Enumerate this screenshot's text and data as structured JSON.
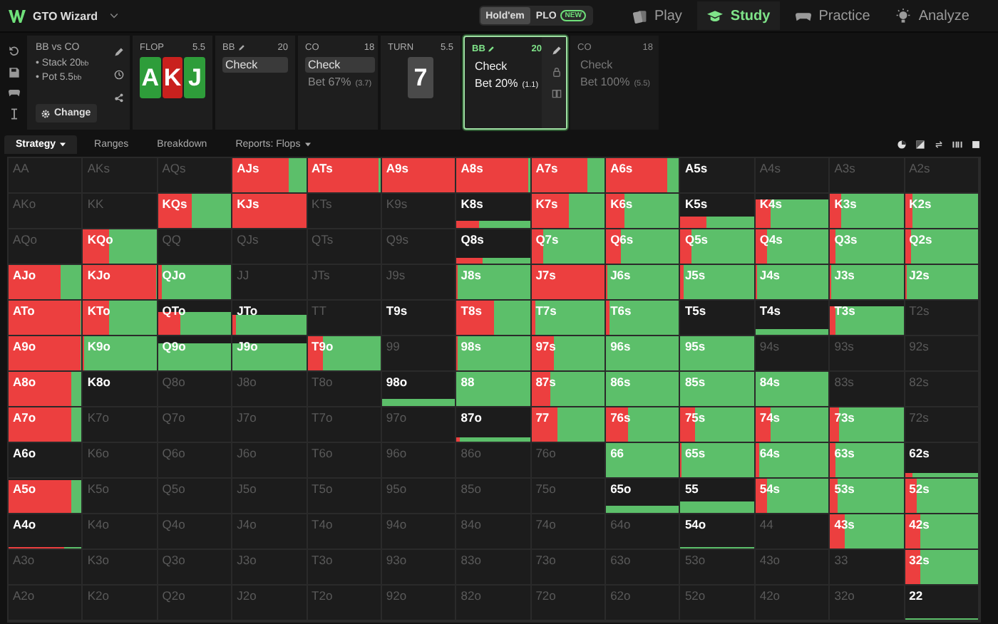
{
  "app": {
    "title": "GTO Wizard"
  },
  "game_toggle": [
    {
      "label": "Hold'em",
      "selected": true
    },
    {
      "label": "PLO",
      "selected": false,
      "badge": "NEW"
    }
  ],
  "nav": [
    {
      "label": "Play",
      "kind": "play",
      "selected": false
    },
    {
      "label": "Study",
      "kind": "study",
      "selected": true
    },
    {
      "label": "Practice",
      "kind": "practice",
      "selected": false
    },
    {
      "label": "Analyze",
      "kind": "analyze",
      "selected": false
    }
  ],
  "scenario": {
    "title": "BB vs CO",
    "details": [
      "• Stack 20$_{bb}$",
      "• Pot 5.5$_{bb}$"
    ],
    "button": "Change"
  },
  "action_cards": [
    {
      "kind": "street",
      "name": "FLOP",
      "pot": "5.5",
      "cards": [
        {
          "rank": "A",
          "color": "#2e9d3a"
        },
        {
          "rank": "K",
          "color": "#c9211e"
        },
        {
          "rank": "J",
          "color": "#2e9d3a"
        }
      ]
    },
    {
      "kind": "player",
      "name": "BB",
      "edited": true,
      "stack": "20",
      "selected": false,
      "dimmed": false,
      "options": [
        {
          "label": "Check",
          "selected": true
        }
      ]
    },
    {
      "kind": "player",
      "name": "CO",
      "edited": false,
      "stack": "18",
      "selected": false,
      "dimmed": false,
      "options": [
        {
          "label": "Check",
          "selected": true
        },
        {
          "label": "Bet 67%",
          "amount": "(3.7)",
          "selected": false
        }
      ]
    },
    {
      "kind": "street",
      "name": "TURN",
      "pot": "5.5",
      "cards": [
        {
          "rank": "7",
          "color": "#4a4a4a"
        }
      ]
    },
    {
      "kind": "player",
      "name": "BB",
      "edited": true,
      "stack": "20",
      "selected": true,
      "dimmed": false,
      "options": [
        {
          "label": "Check",
          "selected": false
        },
        {
          "label": "Bet 20%",
          "amount": "(1.1)",
          "selected": false
        }
      ]
    },
    {
      "kind": "player",
      "name": "CO",
      "edited": false,
      "stack": "18",
      "selected": false,
      "dimmed": true,
      "options": [
        {
          "label": "Check",
          "selected": false
        },
        {
          "label": "Bet 100%",
          "amount": "(5.5)",
          "selected": false
        }
      ]
    }
  ],
  "tabs": [
    {
      "label": "Strategy",
      "selected": true,
      "dropdown": true
    },
    {
      "label": "Ranges",
      "selected": false,
      "dropdown": false
    },
    {
      "label": "Breakdown",
      "selected": false,
      "dropdown": false
    },
    {
      "label": "Reports: Flops",
      "selected": false,
      "dropdown": true
    }
  ],
  "grid": {
    "rows": [
      [
        {
          "hand": "AA",
          "in_range": false
        },
        {
          "hand": "AKs",
          "in_range": false
        },
        {
          "hand": "AQs",
          "in_range": false
        },
        {
          "hand": "AJs",
          "in_range": true
        },
        {
          "hand": "ATs",
          "in_range": true
        },
        {
          "hand": "A9s",
          "in_range": true
        },
        {
          "hand": "A8s",
          "in_range": true
        },
        {
          "hand": "A7s",
          "in_range": true
        },
        {
          "hand": "A6s",
          "in_range": true
        },
        {
          "hand": "A5s",
          "in_range": true
        },
        {
          "hand": "A4s",
          "in_range": false
        },
        {
          "hand": "A3s",
          "in_range": false
        },
        {
          "hand": "A2s",
          "in_range": false
        }
      ],
      [
        {
          "hand": "AKo",
          "in_range": false
        },
        {
          "hand": "KK",
          "in_range": false
        },
        {
          "hand": "KQs",
          "in_range": true
        },
        {
          "hand": "KJs",
          "in_range": true
        },
        {
          "hand": "KTs",
          "in_range": false
        },
        {
          "hand": "K9s",
          "in_range": false
        },
        {
          "hand": "K8s",
          "in_range": true
        },
        {
          "hand": "K7s",
          "in_range": true
        },
        {
          "hand": "K6s",
          "in_range": true
        },
        {
          "hand": "K5s",
          "in_range": true
        },
        {
          "hand": "K4s",
          "in_range": true
        },
        {
          "hand": "K3s",
          "in_range": true
        },
        {
          "hand": "K2s",
          "in_range": true
        }
      ],
      [
        {
          "hand": "AQo",
          "in_range": false
        },
        {
          "hand": "KQo",
          "in_range": true
        },
        {
          "hand": "QQ",
          "in_range": false
        },
        {
          "hand": "QJs",
          "in_range": false
        },
        {
          "hand": "QTs",
          "in_range": false
        },
        {
          "hand": "Q9s",
          "in_range": false
        },
        {
          "hand": "Q8s",
          "in_range": true
        },
        {
          "hand": "Q7s",
          "in_range": true
        },
        {
          "hand": "Q6s",
          "in_range": true
        },
        {
          "hand": "Q5s",
          "in_range": true
        },
        {
          "hand": "Q4s",
          "in_range": true
        },
        {
          "hand": "Q3s",
          "in_range": true
        },
        {
          "hand": "Q2s",
          "in_range": true
        }
      ],
      [
        {
          "hand": "AJo",
          "in_range": true
        },
        {
          "hand": "KJo",
          "in_range": true
        },
        {
          "hand": "QJo",
          "in_range": true
        },
        {
          "hand": "JJ",
          "in_range": false
        },
        {
          "hand": "JTs",
          "in_range": false
        },
        {
          "hand": "J9s",
          "in_range": false
        },
        {
          "hand": "J8s",
          "in_range": true
        },
        {
          "hand": "J7s",
          "in_range": true
        },
        {
          "hand": "J6s",
          "in_range": true
        },
        {
          "hand": "J5s",
          "in_range": true
        },
        {
          "hand": "J4s",
          "in_range": true
        },
        {
          "hand": "J3s",
          "in_range": true
        },
        {
          "hand": "J2s",
          "in_range": true
        }
      ],
      [
        {
          "hand": "ATo",
          "in_range": true
        },
        {
          "hand": "KTo",
          "in_range": true
        },
        {
          "hand": "QTo",
          "in_range": true
        },
        {
          "hand": "JTo",
          "in_range": true
        },
        {
          "hand": "TT",
          "in_range": false
        },
        {
          "hand": "T9s",
          "in_range": true
        },
        {
          "hand": "T8s",
          "in_range": true
        },
        {
          "hand": "T7s",
          "in_range": true
        },
        {
          "hand": "T6s",
          "in_range": true
        },
        {
          "hand": "T5s",
          "in_range": true
        },
        {
          "hand": "T4s",
          "in_range": true
        },
        {
          "hand": "T3s",
          "in_range": true
        },
        {
          "hand": "T2s",
          "in_range": false
        }
      ],
      [
        {
          "hand": "A9o",
          "in_range": true
        },
        {
          "hand": "K9o",
          "in_range": true
        },
        {
          "hand": "Q9o",
          "in_range": true
        },
        {
          "hand": "J9o",
          "in_range": true
        },
        {
          "hand": "T9o",
          "in_range": true
        },
        {
          "hand": "99",
          "in_range": false
        },
        {
          "hand": "98s",
          "in_range": true
        },
        {
          "hand": "97s",
          "in_range": true
        },
        {
          "hand": "96s",
          "in_range": true
        },
        {
          "hand": "95s",
          "in_range": true
        },
        {
          "hand": "94s",
          "in_range": false
        },
        {
          "hand": "93s",
          "in_range": false
        },
        {
          "hand": "92s",
          "in_range": false
        }
      ],
      [
        {
          "hand": "A8o",
          "in_range": true
        },
        {
          "hand": "K8o",
          "in_range": true
        },
        {
          "hand": "Q8o",
          "in_range": false
        },
        {
          "hand": "J8o",
          "in_range": false
        },
        {
          "hand": "T8o",
          "in_range": false
        },
        {
          "hand": "98o",
          "in_range": true
        },
        {
          "hand": "88",
          "in_range": true
        },
        {
          "hand": "87s",
          "in_range": true
        },
        {
          "hand": "86s",
          "in_range": true
        },
        {
          "hand": "85s",
          "in_range": true
        },
        {
          "hand": "84s",
          "in_range": true
        },
        {
          "hand": "83s",
          "in_range": false
        },
        {
          "hand": "82s",
          "in_range": false
        }
      ],
      [
        {
          "hand": "A7o",
          "in_range": true
        },
        {
          "hand": "K7o",
          "in_range": false
        },
        {
          "hand": "Q7o",
          "in_range": false
        },
        {
          "hand": "J7o",
          "in_range": false
        },
        {
          "hand": "T7o",
          "in_range": false
        },
        {
          "hand": "97o",
          "in_range": false
        },
        {
          "hand": "87o",
          "in_range": true
        },
        {
          "hand": "77",
          "in_range": true
        },
        {
          "hand": "76s",
          "in_range": true
        },
        {
          "hand": "75s",
          "in_range": true
        },
        {
          "hand": "74s",
          "in_range": true
        },
        {
          "hand": "73s",
          "in_range": true
        },
        {
          "hand": "72s",
          "in_range": false
        }
      ],
      [
        {
          "hand": "A6o",
          "in_range": true
        },
        {
          "hand": "K6o",
          "in_range": false
        },
        {
          "hand": "Q6o",
          "in_range": false
        },
        {
          "hand": "J6o",
          "in_range": false
        },
        {
          "hand": "T6o",
          "in_range": false
        },
        {
          "hand": "96o",
          "in_range": false
        },
        {
          "hand": "86o",
          "in_range": false
        },
        {
          "hand": "76o",
          "in_range": false
        },
        {
          "hand": "66",
          "in_range": true
        },
        {
          "hand": "65s",
          "in_range": true
        },
        {
          "hand": "64s",
          "in_range": true
        },
        {
          "hand": "63s",
          "in_range": true
        },
        {
          "hand": "62s",
          "in_range": true
        }
      ],
      [
        {
          "hand": "A5o",
          "in_range": true
        },
        {
          "hand": "K5o",
          "in_range": false
        },
        {
          "hand": "Q5o",
          "in_range": false
        },
        {
          "hand": "J5o",
          "in_range": false
        },
        {
          "hand": "T5o",
          "in_range": false
        },
        {
          "hand": "95o",
          "in_range": false
        },
        {
          "hand": "85o",
          "in_range": false
        },
        {
          "hand": "75o",
          "in_range": false
        },
        {
          "hand": "65o",
          "in_range": true
        },
        {
          "hand": "55",
          "in_range": true
        },
        {
          "hand": "54s",
          "in_range": true
        },
        {
          "hand": "53s",
          "in_range": true
        },
        {
          "hand": "52s",
          "in_range": true
        }
      ],
      [
        {
          "hand": "A4o",
          "in_range": true
        },
        {
          "hand": "K4o",
          "in_range": false
        },
        {
          "hand": "Q4o",
          "in_range": false
        },
        {
          "hand": "J4o",
          "in_range": false
        },
        {
          "hand": "T4o",
          "in_range": false
        },
        {
          "hand": "94o",
          "in_range": false
        },
        {
          "hand": "84o",
          "in_range": false
        },
        {
          "hand": "74o",
          "in_range": false
        },
        {
          "hand": "64o",
          "in_range": false
        },
        {
          "hand": "54o",
          "in_range": true
        },
        {
          "hand": "44",
          "in_range": false
        },
        {
          "hand": "43s",
          "in_range": true
        },
        {
          "hand": "42s",
          "in_range": true
        }
      ],
      [
        {
          "hand": "A3o",
          "in_range": false
        },
        {
          "hand": "K3o",
          "in_range": false
        },
        {
          "hand": "Q3o",
          "in_range": false
        },
        {
          "hand": "J3o",
          "in_range": false
        },
        {
          "hand": "T3o",
          "in_range": false
        },
        {
          "hand": "93o",
          "in_range": false
        },
        {
          "hand": "83o",
          "in_range": false
        },
        {
          "hand": "73o",
          "in_range": false
        },
        {
          "hand": "63o",
          "in_range": false
        },
        {
          "hand": "53o",
          "in_range": false
        },
        {
          "hand": "43o",
          "in_range": false
        },
        {
          "hand": "33",
          "in_range": false
        },
        {
          "hand": "32s",
          "in_range": true
        }
      ],
      [
        {
          "hand": "A2o",
          "in_range": false
        },
        {
          "hand": "K2o",
          "in_range": false
        },
        {
          "hand": "Q2o",
          "in_range": false
        },
        {
          "hand": "J2o",
          "in_range": false
        },
        {
          "hand": "T2o",
          "in_range": false
        },
        {
          "hand": "92o",
          "in_range": false
        },
        {
          "hand": "82o",
          "in_range": false
        },
        {
          "hand": "72o",
          "in_range": false
        },
        {
          "hand": "62o",
          "in_range": false
        },
        {
          "hand": "52o",
          "in_range": false
        },
        {
          "hand": "42o",
          "in_range": false
        },
        {
          "hand": "32o",
          "in_range": false
        },
        {
          "hand": "22",
          "in_range": true
        }
      ]
    ]
  }
}
